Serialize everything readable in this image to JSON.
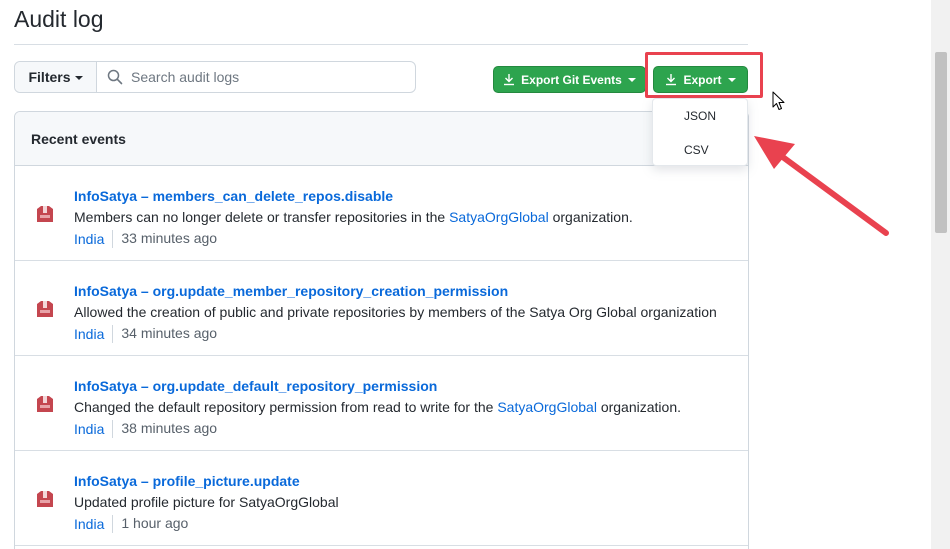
{
  "page": {
    "title": "Audit log"
  },
  "toolbar": {
    "filters_label": "Filters",
    "search_placeholder": "Search audit logs",
    "export_git_label": "Export Git Events",
    "export_label": "Export"
  },
  "dropdown": {
    "items": [
      "JSON",
      "CSV"
    ]
  },
  "panel": {
    "header": "Recent events"
  },
  "events": [
    {
      "actor": "InfoSatya",
      "action": "members_can_delete_repos.disable",
      "desc_before": "Members can no longer delete or transfer repositories in the ",
      "desc_link": "SatyaOrgGlobal",
      "desc_after": " organization.",
      "location": "India",
      "time": "33 minutes ago"
    },
    {
      "actor": "InfoSatya",
      "action": "org.update_member_repository_creation_permission",
      "desc_before": "Allowed the creation of public and private repositories by members of the Satya Org Global organization",
      "desc_link": "",
      "desc_after": "",
      "location": "India",
      "time": "34 minutes ago"
    },
    {
      "actor": "InfoSatya",
      "action": "org.update_default_repository_permission",
      "desc_before": "Changed the default repository permission from read to write for the ",
      "desc_link": "SatyaOrgGlobal",
      "desc_after": " organization.",
      "location": "India",
      "time": "38 minutes ago"
    },
    {
      "actor": "InfoSatya",
      "action": "profile_picture.update",
      "desc_before": "Updated profile picture for SatyaOrgGlobal",
      "desc_link": "",
      "desc_after": "",
      "location": "India",
      "time": "1 hour ago"
    }
  ],
  "colors": {
    "accent_green": "#2da44e",
    "link_blue": "#0969da",
    "annotation_red": "#e9424f",
    "avatar": "#c4464f"
  }
}
